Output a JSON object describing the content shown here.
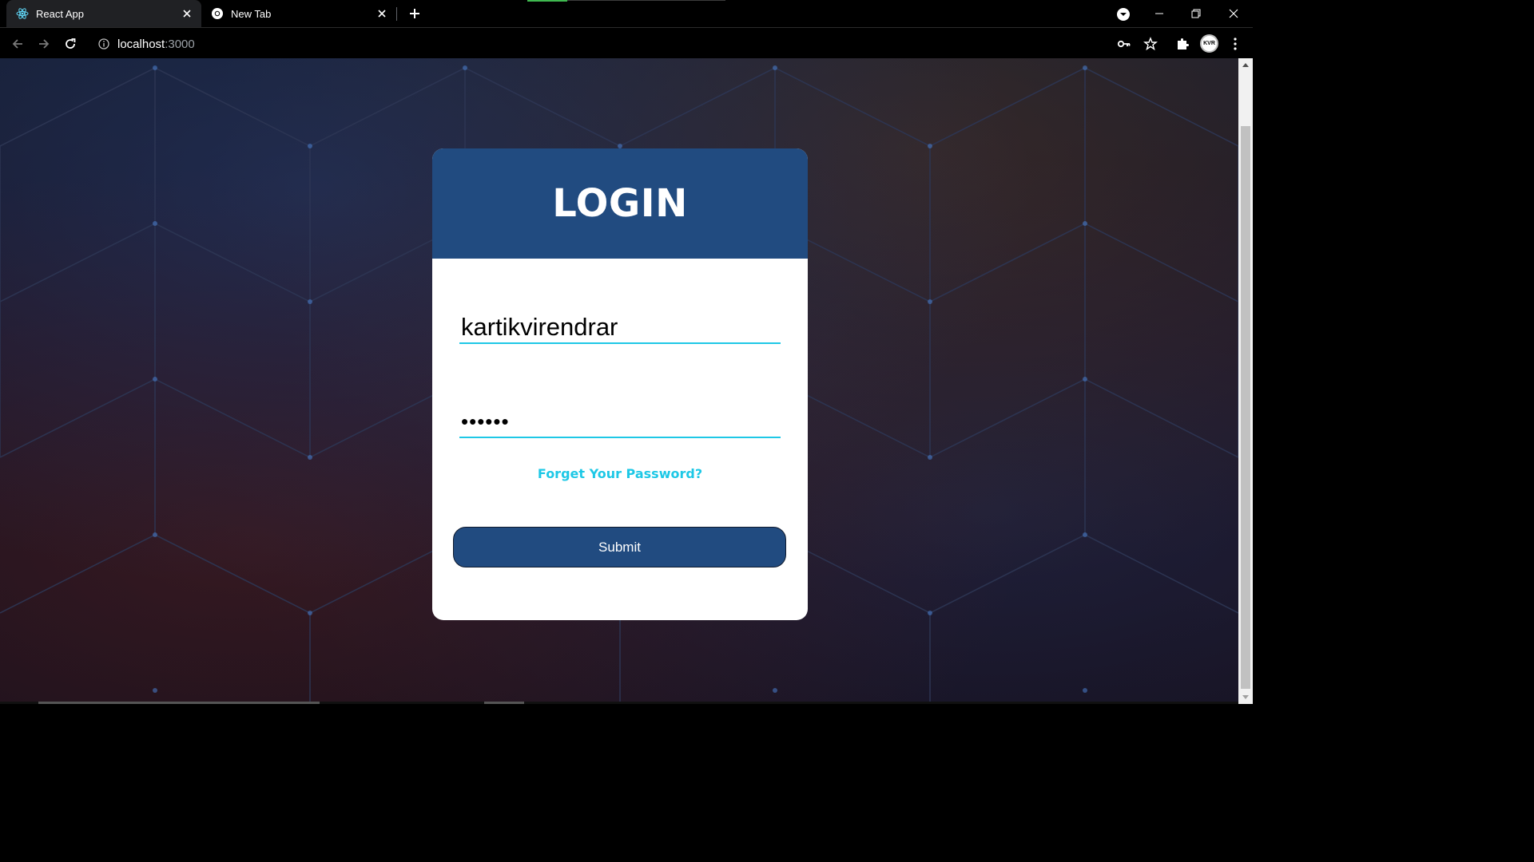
{
  "browser": {
    "tabs": [
      {
        "label": "React App",
        "active": true,
        "icon": "react-icon"
      },
      {
        "label": "New Tab",
        "active": false,
        "icon": "chrome-icon"
      }
    ],
    "address": {
      "host": "localhost",
      "port": ":3000"
    }
  },
  "login": {
    "title": "LOGIN",
    "username_value": "kartikvirendrar",
    "password_value": "••••••",
    "forgot_label": "Forget Your Password?",
    "submit_label": "Submit"
  },
  "colors": {
    "card_header": "#214b80",
    "accent": "#1ec8e6",
    "button": "#214b80"
  }
}
